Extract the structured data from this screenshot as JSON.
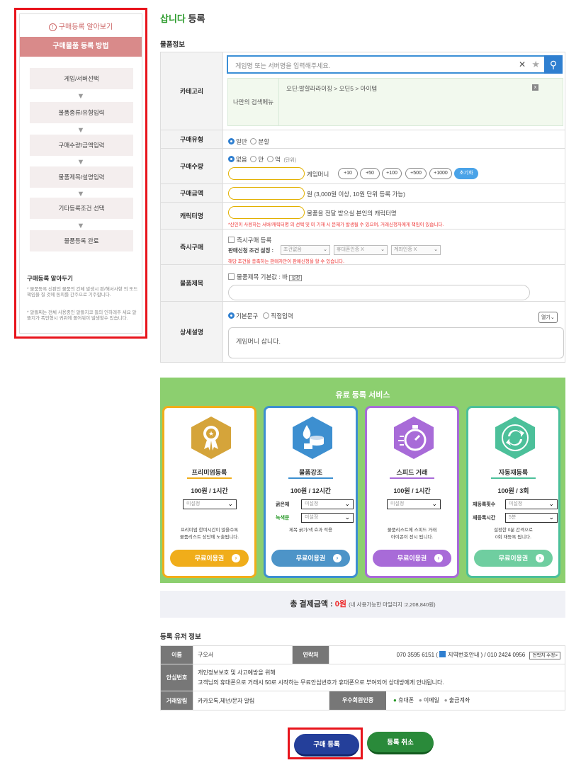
{
  "guide": {
    "title": "구매등록 알아보기",
    "header": "구매물품 등록 방법",
    "steps": [
      "게임/서버선택",
      "물품종류/유형입력",
      "구매수량/금액입력",
      "물품제목/설명입력",
      "기타등록조건 선택",
      "물품등록 완료"
    ],
    "notes_title": "구매등록 알아두기",
    "note1": "* 물품등록 신판인 물품의 간체 발생시 판/해서사항 의 또드 책임을 질 것에 동의를 간주으로 기주합니다.",
    "note2": "* 알뜰찌는 전체 사용중인 알뜰지코 들의 인하래주 세요 알뜰지가 폭인형시 귀위에 폴어워이 발생할수 있습니다."
  },
  "page": {
    "title_green": "삽니다",
    "title_rest": "등록",
    "section_item": "물품정보"
  },
  "category": {
    "label": "카테고리",
    "search_placeholder": "게임명 또는 서버명을 입력해주세요.",
    "my_menu": "나만의 검색메뉴",
    "path": "오딘:발할라라이징 > 오딘5 > 아이템"
  },
  "purchase_type": {
    "label": "구매유형",
    "opt1": "일반",
    "opt2": "분할"
  },
  "quantity": {
    "label": "구매수량",
    "units": [
      "없음",
      "만",
      "억"
    ],
    "unit_note": "(단위)",
    "suffix": "게임머니",
    "pills": [
      "+10",
      "+50",
      "+100",
      "+500",
      "+1000"
    ],
    "reset": "초기화"
  },
  "price": {
    "label": "구매금액",
    "suffix": "원 (3,000원 이상, 10원 단위 등록 가능)"
  },
  "character": {
    "label": "캐릭터명",
    "desc": "물품을 전달 받으실 본인의 캐릭터명",
    "warn": "*신인이 사용하는 서버/캐릭터명 의 선택 및 미 기재 시 문제가 발생될 수 있으며, 거래신청자에게 책임이 있습니다."
  },
  "instant": {
    "label": "즉시구매",
    "check": "즉시구매 등록",
    "cond_label": "판매신청 조건 설정 :",
    "sel1": "조건없음",
    "sel2": "휴대폰인증 X",
    "sel3": "계좌인증 X",
    "warn": "해당 조건을 충족하는 판매자만이 판매신청을 할 수 있습니다."
  },
  "item_title": {
    "label": "물품제목",
    "check": "물품제목 기본값 : 바",
    "set_btn": "설정"
  },
  "detail": {
    "label": "상세설명",
    "opt1": "기본문구",
    "opt2": "직접입력",
    "open_btn": "열기",
    "text": "게임머니 삽니다."
  },
  "paid": {
    "title": "유료 등록 서비스",
    "cards": [
      {
        "name": "프리미엄등록",
        "price": "100원 / 1시간",
        "select": "미설정",
        "desc1": "프리미엄 한여시간이 많을수록",
        "desc2": "물품리스트 상단에 노출됩니다.",
        "btn": "무료이용권",
        "color": "#f0ad1a",
        "icon": "premium-ribbon-icon"
      },
      {
        "name": "물품강조",
        "price": "100원 / 12시간",
        "l1": "굵은체",
        "l2": "녹색문",
        "select1": "미설정",
        "select2": "미설정",
        "desc1": "제목 굵기/색 효과 적용",
        "btn": "무료이용권",
        "color": "#3d8fd0",
        "icon": "coin-highlight-icon"
      },
      {
        "name": "스피드 거래",
        "price": "100원 / 1시간",
        "select": "미설정",
        "desc1": "물품리스트에 스피드 거래",
        "desc2": "아이콘이 전시 됩니다.",
        "btn": "무료이용권",
        "color": "#a86bd8",
        "icon": "stopwatch-icon"
      },
      {
        "name": "자동재등록",
        "price": "100원 / 3회",
        "l1": "재등록횟수",
        "l2": "재등록시간",
        "select1": "미설정",
        "select2": "5분",
        "desc1": "설정한 0분 간격으로",
        "desc2": "0회 재등록 됩니다.",
        "btn": "무료이용권",
        "color": "#4cc09a",
        "icon": "refresh-arrows-icon"
      }
    ]
  },
  "total": {
    "label": "총 결제금액 :",
    "amount": "0원",
    "avail_pre": "(내 사용가능한 마일리지 :",
    "avail_amt": "2,208,840원",
    "avail_post": ")"
  },
  "user": {
    "section": "등록 유저 정보",
    "name_label": "이름",
    "name": "구오서",
    "contact_label": "연락처",
    "contact_pre": "070 3595 6151 (",
    "contact_mid": "지역번호안내 ) / 010 2424 0956",
    "edit_btn": "연락처 수정>",
    "safe_label": "안심번호",
    "safe1": "개인정보보호 및 사고예방을 위해",
    "safe2": "고객님의 휴대폰으로 거래시 50로 시작하는 무료안심번호가 휴대폰으로 부여되어 상대방에게 안내됩니다.",
    "alert_label": "거래알림",
    "alert": "카카오톡,체넌/문자 알림",
    "pref_label": "우수회원인증",
    "pref1": "휴대폰",
    "pref2": "이메일",
    "pref3": "출금계좌"
  },
  "buttons": {
    "submit": "구매 등록",
    "cancel": "등록 취소"
  }
}
